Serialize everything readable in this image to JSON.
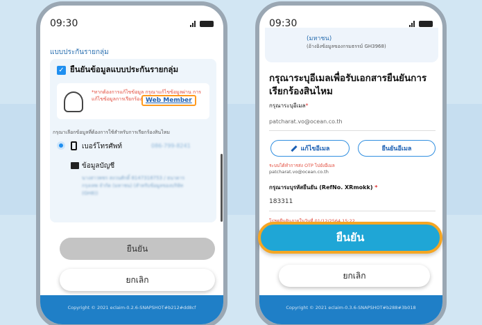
{
  "left": {
    "time": "09:30",
    "section_title": "แบบประกันรายกลุ่ม",
    "checkbox_label": "ยืนยันข้อมูลแบบประกันรายกลุ่ม",
    "notice_text": "*หากต้องการแก้ไขข้อมูล กรุณาแก้ไขข้อมูลผ่าน การแก้ไขข้อมูลการเรียกร้องสินไหม",
    "web_member_link": "Web Member",
    "choose_text": "กรุณาเลือกข้อมูลที่ต้องการใช้สำหรับการเรียกร้องสินไหม",
    "phone_label": "เบอร์โทรศัพท์",
    "phone_value": "086-799-8241",
    "account_label": "ข้อมูลบัญชี",
    "account_info": "นางสาวพชร สงวนศักดิ์ 8147318753 / ธนาคารกรุงเทพ จำกัด (มหาชน) (สำหรับข้อมูลของบริษัท (GH8))",
    "confirm_label": "ยืนยัน",
    "cancel_label": "ยกเลิก",
    "footer": "Copyright © 2021 eclaim-0.2.6-SNAPSHOT#b212#dd8cf"
  },
  "right": {
    "time": "09:30",
    "top_card_line1": "(มหาชน)",
    "top_card_line2": "(อ้างอิงข้อมูลของกรมธรรม์ GH3968)",
    "title": "กรุณาระบุอีเมลเพื่อรับเอกสารยืนยันการเรียกร้องสินไหม",
    "email_label": "กรุณาระบุอีเมล",
    "email_required": "*",
    "email_value": "patcharat.vo@ocean.co.th",
    "edit_email_label": "แก้ไขอีเมล",
    "verify_email_label": "ยืนยันอีเมล",
    "otp_note": "ระบบได้ทำการส่ง OTP ไปยังอีเมล",
    "otp_email": "patcharat.vo@ocean.co.th",
    "ref_label": "กรุณาระบุรหัสยืนยัน (RefNo. XRmokk)",
    "ref_required": "*",
    "ref_value": "183311",
    "expiry_text": "โปรดยืนยันภายในวันที่ 01/12/2564 15:22",
    "confirm_label": "ยืนยัน",
    "cancel_label": "ยกเลิก",
    "footer": "Copyright © 2021 eclaim-0.3.6-SNAPSHOT#b288#3b018"
  },
  "colors": {
    "primary": "#1f8ff0",
    "confirm_active": "#1fa6d6",
    "highlight": "#f5a623",
    "footer": "#1f7fc7"
  }
}
